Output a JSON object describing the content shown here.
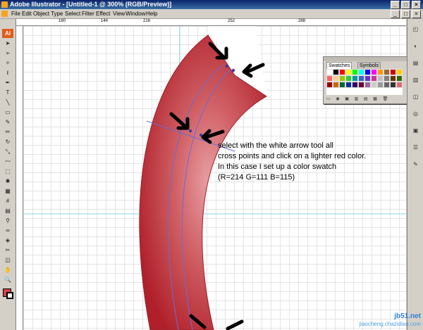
{
  "window": {
    "title": "Adobe Illustrator - [Untitled-1 @ 300% (RGB/Preview)]",
    "controls": [
      "_",
      "□",
      "×"
    ]
  },
  "menubar": {
    "items": [
      "File",
      "Edit",
      "Object",
      "Type",
      "Select",
      "Filter",
      "Effect",
      "View",
      "Window",
      "Help"
    ],
    "doc_controls": [
      "_",
      "□",
      "×"
    ]
  },
  "toolbox": {
    "logo": "Ai",
    "tools": [
      {
        "icon": "selection-tool-icon",
        "glyph": "➤"
      },
      {
        "icon": "direct-selection-tool-icon",
        "glyph": "➢"
      },
      {
        "icon": "magic-wand-tool-icon",
        "glyph": "✧"
      },
      {
        "icon": "lasso-tool-icon",
        "glyph": "ℓ"
      },
      {
        "icon": "pen-tool-icon",
        "glyph": "✒"
      },
      {
        "icon": "type-tool-icon",
        "glyph": "T"
      },
      {
        "icon": "line-tool-icon",
        "glyph": "╲"
      },
      {
        "icon": "rectangle-tool-icon",
        "glyph": "▭"
      },
      {
        "icon": "paintbrush-tool-icon",
        "glyph": "✎"
      },
      {
        "icon": "pencil-tool-icon",
        "glyph": "✏"
      },
      {
        "icon": "rotate-tool-icon",
        "glyph": "↻"
      },
      {
        "icon": "scale-tool-icon",
        "glyph": "⤡"
      },
      {
        "icon": "warp-tool-icon",
        "glyph": "〰"
      },
      {
        "icon": "free-transform-tool-icon",
        "glyph": "⬚"
      },
      {
        "icon": "symbol-sprayer-tool-icon",
        "glyph": "✺"
      },
      {
        "icon": "graph-tool-icon",
        "glyph": "▦"
      },
      {
        "icon": "mesh-tool-icon",
        "glyph": "#"
      },
      {
        "icon": "gradient-tool-icon",
        "glyph": "▤"
      },
      {
        "icon": "eyedropper-tool-icon",
        "glyph": "⚲"
      },
      {
        "icon": "blend-tool-icon",
        "glyph": "∞"
      },
      {
        "icon": "live-paint-tool-icon",
        "glyph": "◈"
      },
      {
        "icon": "slice-tool-icon",
        "glyph": "✂"
      },
      {
        "icon": "eraser-tool-icon",
        "glyph": "◫"
      },
      {
        "icon": "hand-tool-icon",
        "glyph": "✋"
      },
      {
        "icon": "zoom-tool-icon",
        "glyph": "🔍"
      }
    ]
  },
  "rulers": {
    "horizontal_labels": [
      "180",
      "144",
      "216",
      "252",
      "288"
    ]
  },
  "swatches_panel": {
    "tabs": [
      "Swatches",
      "Symbols"
    ],
    "colors": [
      "#ffffff",
      "#000000",
      "#ff0000",
      "#ffff00",
      "#00ff00",
      "#00ffff",
      "#0000ff",
      "#ff00ff",
      "#ff9900",
      "#996633",
      "#cc0000",
      "#ffcc00",
      "#ff6666",
      "#ffcc99",
      "#99cc00",
      "#33cc33",
      "#009999",
      "#3366cc",
      "#6633cc",
      "#cc3399",
      "#c0c0c0",
      "#808080",
      "#663300",
      "#336600",
      "#990000",
      "#cc6600",
      "#006633",
      "#003399",
      "#330066",
      "#660033",
      "#996699",
      "#cccccc",
      "#999999",
      "#666666",
      "#333333",
      "#d66f73"
    ],
    "footer_icons": "▭ ◉ ▣ ▥ ▤ ▦ 🗑"
  },
  "instruction_note": {
    "lines": [
      "select with the white arrow tool all",
      "cross points and click on a lighter red color.",
      "In this case I set up a color swatch",
      "(R=214 G=111 B=115)"
    ]
  },
  "watermark": {
    "top": "jb51.net",
    "bottom": "jiaocheng.chazidian.com"
  },
  "colors": {
    "shape_fill": "#c8323d",
    "shape_highlight": "#d66f73",
    "path_stroke": "#6a6ad8",
    "guide": "#7fd8e8"
  }
}
